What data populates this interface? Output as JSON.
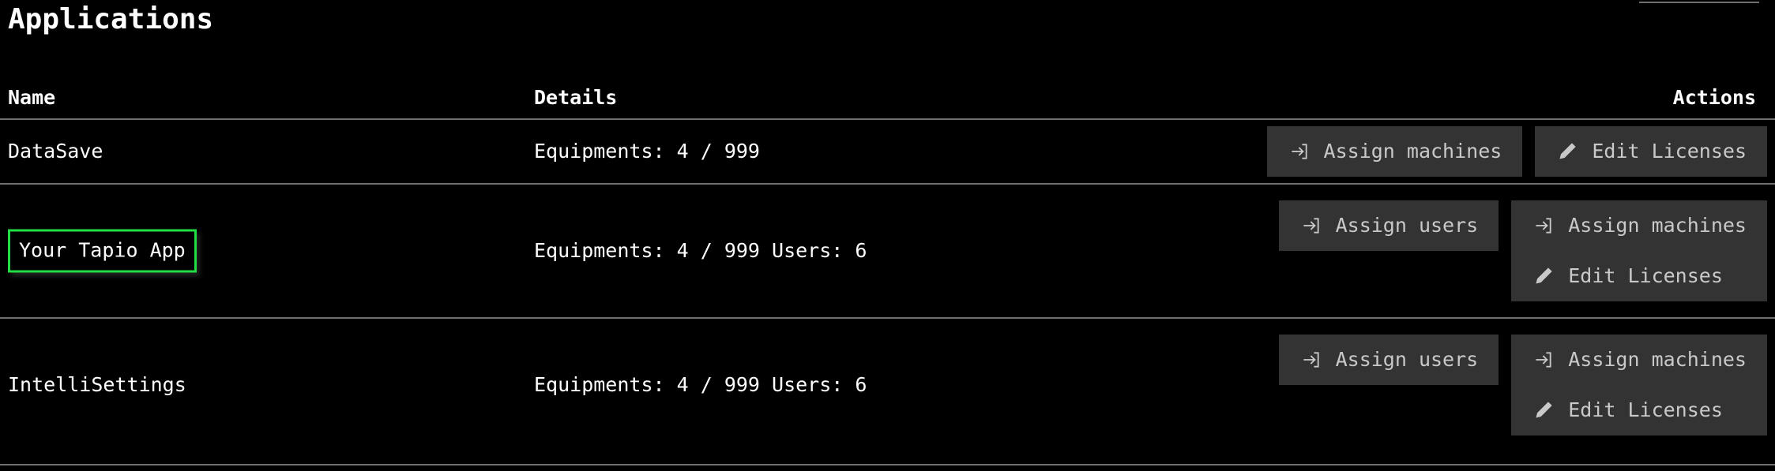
{
  "page": {
    "title": "Applications"
  },
  "table": {
    "columns": {
      "name": "Name",
      "details": "Details",
      "actions": "Actions"
    },
    "rows": [
      {
        "name": "DataSave",
        "details": "Equipments: 4 / 999",
        "highlighted": false,
        "actions": [
          {
            "label": "Assign machines",
            "icon": "login-arrow-icon"
          },
          {
            "label": "Edit Licenses",
            "icon": "pencil-icon"
          }
        ]
      },
      {
        "name": "Your Tapio App",
        "details": "Equipments: 4 / 999 Users: 6",
        "highlighted": true,
        "actions": [
          {
            "label": "Assign users",
            "icon": "login-arrow-icon"
          },
          {
            "label": "Assign machines",
            "icon": "login-arrow-icon"
          },
          {
            "label": "Edit Licenses",
            "icon": "pencil-icon"
          }
        ]
      },
      {
        "name": "IntelliSettings",
        "details": "Equipments: 4 / 999 Users: 6",
        "highlighted": false,
        "actions": [
          {
            "label": "Assign users",
            "icon": "login-arrow-icon"
          },
          {
            "label": "Assign machines",
            "icon": "login-arrow-icon"
          },
          {
            "label": "Edit Licenses",
            "icon": "pencil-icon"
          }
        ]
      }
    ]
  },
  "colors": {
    "background": "#000000",
    "text": "#ffffff",
    "button_background": "#333333",
    "button_text": "#c9c9c9",
    "divider": "#6f6f6f",
    "highlight_border": "#22dd44"
  }
}
